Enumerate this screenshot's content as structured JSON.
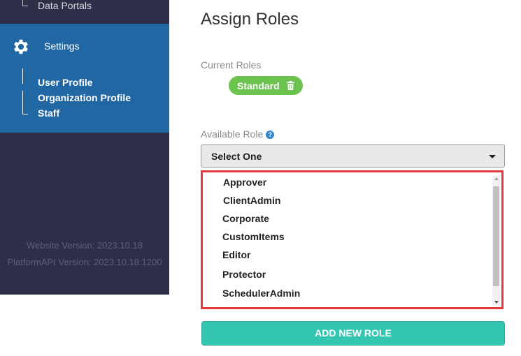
{
  "sidebar": {
    "top_item_label": "Data Portals",
    "settings_label": "Settings",
    "sub_items": [
      {
        "label": "User Profile"
      },
      {
        "label": "Organization Profile"
      },
      {
        "label": "Staff"
      }
    ],
    "website_version": "Website Version: 2023.10.18",
    "platform_version": "PlatformAPI Version: 2023.10.18.1200"
  },
  "main": {
    "title": "Assign Roles",
    "current_roles_label": "Current Roles",
    "current_roles": [
      {
        "label": "Standard"
      }
    ],
    "available_role_label": "Available Role",
    "select": {
      "value": "Select One"
    },
    "options": [
      "Approver",
      "ClientAdmin",
      "Corporate",
      "CustomItems",
      "Editor",
      "Protector",
      "SchedulerAdmin"
    ],
    "add_button_label": "ADD NEW ROLE"
  },
  "colors": {
    "sidebar_bg": "#2f2e48",
    "settings_bg": "#2167a3",
    "role_pill": "#6bc24f",
    "dropdown_highlight": "#e03a3e",
    "add_button": "#34c6b0"
  },
  "icons": {
    "settings": "gear-icon",
    "remove_role": "trash-icon",
    "help": "question-circle-icon",
    "select_caret": "caret-down-icon"
  }
}
